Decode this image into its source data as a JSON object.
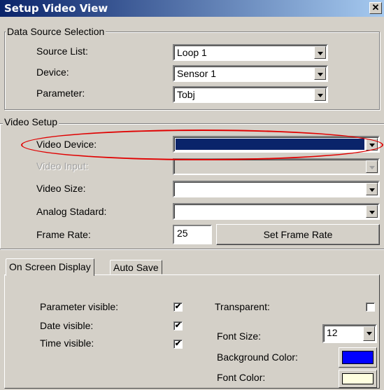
{
  "window": {
    "title": "Setup Video View"
  },
  "data_source": {
    "legend": "Data Source Selection",
    "source_list": {
      "label": "Source List:",
      "value": "Loop 1"
    },
    "device": {
      "label": "Device:",
      "value": "Sensor 1"
    },
    "parameter": {
      "label": "Parameter:",
      "value": "Tobj"
    }
  },
  "video_setup": {
    "legend": "Video Setup",
    "video_device": {
      "label": "Video Device:",
      "value": ""
    },
    "video_input": {
      "label": "Video Input:",
      "value": ""
    },
    "video_size": {
      "label": "Video Size:",
      "value": ""
    },
    "analog_standard": {
      "label": "Analog Stadard:",
      "value": ""
    },
    "frame_rate": {
      "label": "Frame Rate:",
      "value": "25",
      "button_label": "Set Frame Rate"
    }
  },
  "tabs": [
    {
      "label": "On Screen Display",
      "active": true
    },
    {
      "label": "Auto Save",
      "active": false
    }
  ],
  "osd": {
    "parameter_visible": {
      "label": "Parameter visible:",
      "checked": true,
      "mark": "✔"
    },
    "date_visible": {
      "label": "Date visible:",
      "checked": true,
      "mark": "✔"
    },
    "time_visible": {
      "label": "Time visible:",
      "checked": true,
      "mark": "✔"
    },
    "transparent": {
      "label": "Transparent:",
      "checked": false,
      "mark": ""
    },
    "font_size": {
      "label": "Font Size:",
      "value": "12"
    },
    "background_color": {
      "label": "Background Color:",
      "color": "#0000ff"
    },
    "font_color": {
      "label": "Font Color:",
      "color": "#ffffe0"
    }
  },
  "highlight": {
    "color": "#e00000",
    "target": "video_device"
  }
}
